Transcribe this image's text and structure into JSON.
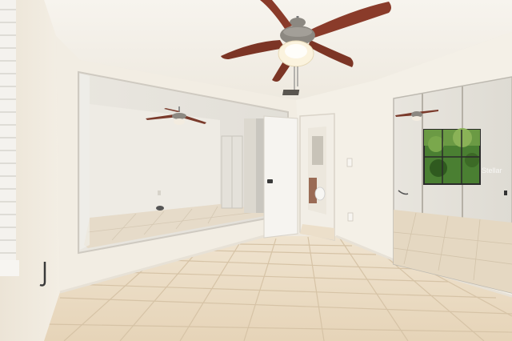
{
  "photo": {
    "subject": "empty-bedroom",
    "watermark_text": "Stellar",
    "colors": {
      "wall": "#f1ece2",
      "ceiling": "#f6f2ea",
      "floor_tile": "#eadbc4",
      "grout": "#d8c6ab",
      "fan_blade": "#8a3b2a",
      "fan_metal": "#8c8881",
      "mirror": "#e4e2dc",
      "window_green": "#3f7a2c"
    }
  }
}
